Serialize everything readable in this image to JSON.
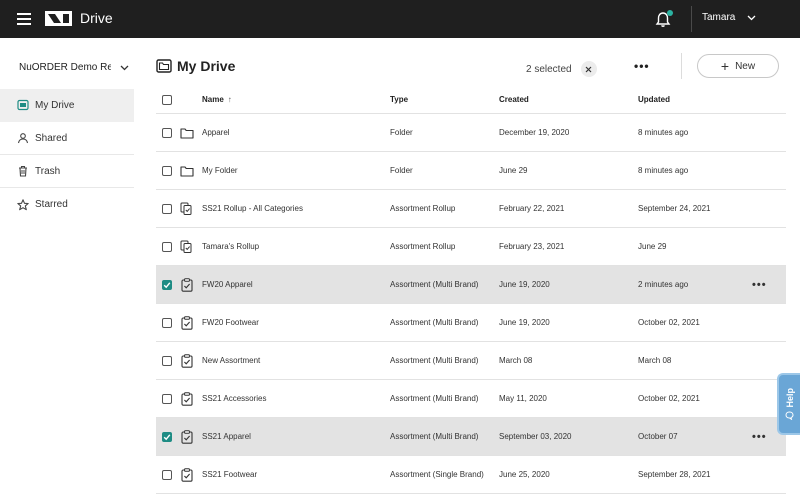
{
  "topbar": {
    "app_title": "Drive",
    "user_name": "Tamara",
    "accent": "#2bb3a2"
  },
  "sidebar": {
    "org_name": "NuORDER Demo Reta...",
    "items": [
      {
        "label": "My Drive",
        "icon": "drive-icon",
        "active": true
      },
      {
        "label": "Shared",
        "icon": "person-icon",
        "active": false
      },
      {
        "label": "Trash",
        "icon": "trash-icon",
        "active": false
      },
      {
        "label": "Starred",
        "icon": "star-icon",
        "active": false
      }
    ]
  },
  "header": {
    "title": "My Drive",
    "selected_count": "2 selected",
    "more_label": "•••",
    "new_label": "New"
  },
  "table": {
    "columns": {
      "name": "Name",
      "type": "Type",
      "created": "Created",
      "updated": "Updated"
    },
    "rows": [
      {
        "name": "Apparel",
        "type": "Folder",
        "created": "December 19, 2020",
        "updated": "8 minutes ago",
        "icon": "folder-icon",
        "selected": false
      },
      {
        "name": "My Folder",
        "type": "Folder",
        "created": "June 29",
        "updated": "8 minutes ago",
        "icon": "folder-icon",
        "selected": false
      },
      {
        "name": "SS21 Rollup - All Categories",
        "type": "Assortment Rollup",
        "created": "February 22, 2021",
        "updated": "September 24, 2021",
        "icon": "rollup-icon",
        "selected": false
      },
      {
        "name": "Tamara's Rollup",
        "type": "Assortment Rollup",
        "created": "February 23, 2021",
        "updated": "June 29",
        "icon": "rollup-icon",
        "selected": false
      },
      {
        "name": "FW20 Apparel",
        "type": "Assortment (Multi Brand)",
        "created": "June 19, 2020",
        "updated": "2 minutes ago",
        "icon": "clipboard-icon",
        "selected": true,
        "more": "•••"
      },
      {
        "name": "FW20 Footwear",
        "type": "Assortment (Multi Brand)",
        "created": "June 19, 2020",
        "updated": "October 02, 2021",
        "icon": "clipboard-icon",
        "selected": false
      },
      {
        "name": "New Assortment",
        "type": "Assortment (Multi Brand)",
        "created": "March 08",
        "updated": "March 08",
        "icon": "clipboard-icon",
        "selected": false
      },
      {
        "name": "SS21 Accessories",
        "type": "Assortment (Multi Brand)",
        "created": "May 11, 2020",
        "updated": "October 02, 2021",
        "icon": "clipboard-icon",
        "selected": false
      },
      {
        "name": "SS21 Apparel",
        "type": "Assortment (Multi Brand)",
        "created": "September 03, 2020",
        "updated": "October 07",
        "icon": "clipboard-icon",
        "selected": true,
        "more": "•••"
      },
      {
        "name": "SS21 Footwear",
        "type": "Assortment (Single Brand)",
        "created": "June 25, 2020",
        "updated": "September 28, 2021",
        "icon": "clipboard-icon",
        "selected": false
      }
    ]
  },
  "help": {
    "label": "Help"
  },
  "colors": {
    "topbar_bg": "#1f1f1f",
    "checkbox_checked": "#1e8c84",
    "selected_row": "#e3e3e3",
    "help_tab": "#6aa6d6"
  }
}
